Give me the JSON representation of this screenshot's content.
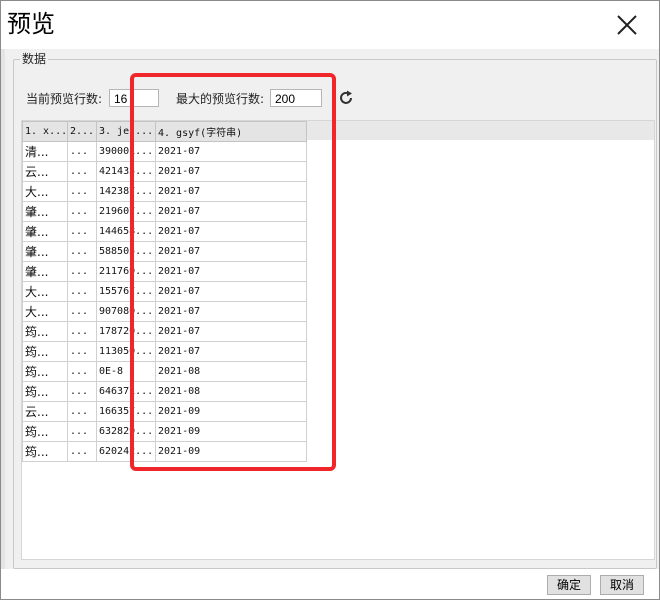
{
  "dialog": {
    "title": "预览",
    "close_icon": "close-icon"
  },
  "group": {
    "title": "数据",
    "current_rows_label": "当前预览行数:",
    "current_rows_value": "16",
    "max_rows_label": "最大的预览行数:",
    "max_rows_value": "200",
    "refresh_icon": "refresh-icon"
  },
  "grid": {
    "columns": [
      "1. x...",
      "2...",
      "3. je(...",
      "4. gsyf(字符串)"
    ],
    "rows": [
      [
        "清...",
        "...",
        "390001...",
        "2021-07"
      ],
      [
        "云...",
        "...",
        "421435...",
        "2021-07"
      ],
      [
        "大...",
        "...",
        "142387...",
        "2021-07"
      ],
      [
        "肇...",
        "...",
        "219607...",
        "2021-07"
      ],
      [
        "肇...",
        "...",
        "144658...",
        "2021-07"
      ],
      [
        "肇...",
        "...",
        "588505...",
        "2021-07"
      ],
      [
        "肇...",
        "...",
        "211769...",
        "2021-07"
      ],
      [
        "大...",
        "...",
        "155767...",
        "2021-07"
      ],
      [
        "大...",
        "...",
        "907080...",
        "2021-07"
      ],
      [
        "筠...",
        "...",
        "178720...",
        "2021-07"
      ],
      [
        "筠...",
        "...",
        "113050...",
        "2021-07"
      ],
      [
        "筠...",
        "...",
        "0E-8",
        "2021-08"
      ],
      [
        "筠...",
        "...",
        "646371...",
        "2021-08"
      ],
      [
        "云...",
        "...",
        "166357...",
        "2021-09"
      ],
      [
        "筠...",
        "...",
        "632829...",
        "2021-09"
      ],
      [
        "筠...",
        "...",
        "620242...",
        "2021-09"
      ]
    ]
  },
  "footer": {
    "ok_label": "确定",
    "cancel_label": "取消"
  },
  "colors": {
    "highlight": "#f0262a",
    "panel_bg": "#f0f0f0",
    "header_bg": "#e4e4e4"
  }
}
